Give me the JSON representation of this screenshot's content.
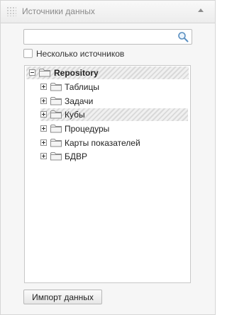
{
  "header": {
    "title": "Источники данных"
  },
  "search": {
    "value": "",
    "placeholder": ""
  },
  "multi_source": {
    "label": "Несколько источников",
    "checked": false
  },
  "tree": {
    "root": {
      "label": "Repository",
      "expanded": true
    },
    "children": [
      {
        "label": "Таблицы"
      },
      {
        "label": "Задачи"
      },
      {
        "label": "Кубы"
      },
      {
        "label": "Процедуры"
      },
      {
        "label": "Карты показателей"
      },
      {
        "label": "БДВР"
      }
    ]
  },
  "import_button": {
    "label": "Импорт данных"
  },
  "colors": {
    "panel_bg": "#f6f6f6",
    "border": "#c8c8c8",
    "selection_stripe": "#d9d9d9"
  }
}
